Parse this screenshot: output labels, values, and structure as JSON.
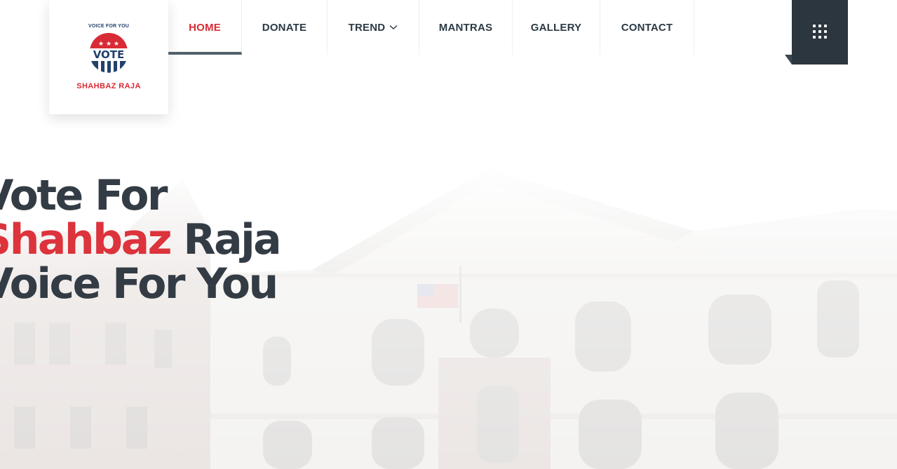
{
  "logo": {
    "tagline": "VOICE FOR YOU",
    "badge_text": "VOTE",
    "name": "SHAHBAZ RAJA"
  },
  "nav": {
    "items": [
      {
        "label": "HOME",
        "active": true
      },
      {
        "label": "DONATE"
      },
      {
        "label": "TREND",
        "has_dropdown": true
      },
      {
        "label": "MANTRAS"
      },
      {
        "label": "GALLERY"
      },
      {
        "label": "CONTACT"
      }
    ]
  },
  "hero": {
    "line1": "Vote For",
    "line2_highlight": "Shahbaz",
    "line2_rest": " Raja",
    "line3": "Voice For You"
  },
  "icons": {
    "menu": "grid-dots-icon",
    "dropdown": "chevron-down-icon"
  },
  "colors": {
    "accent_red": "#dc333c",
    "dark": "#2c363f",
    "logo_blue": "#23416b"
  }
}
